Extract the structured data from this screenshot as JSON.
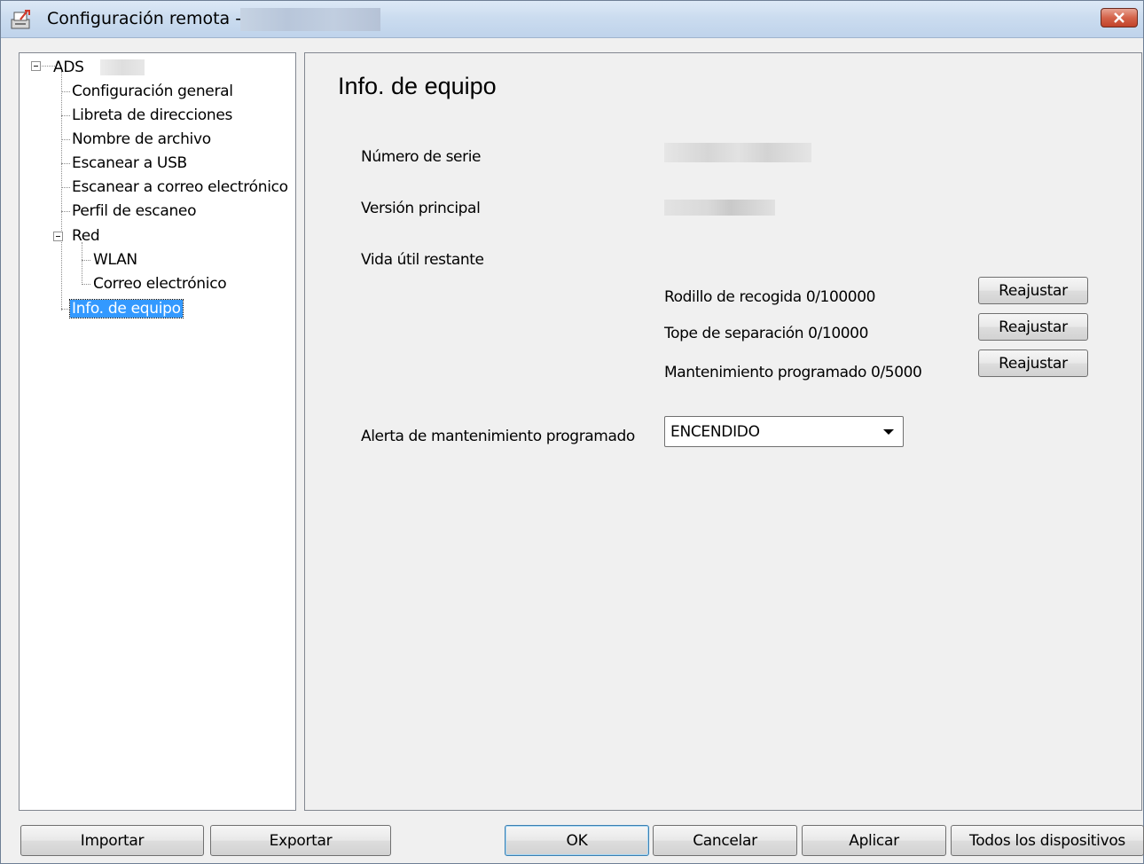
{
  "window": {
    "title": "Configuración remota -",
    "close_icon": "close-icon"
  },
  "tree": {
    "root_label": "ADS",
    "items": [
      {
        "label": "Configuración general"
      },
      {
        "label": "Libreta de direcciones"
      },
      {
        "label": "Nombre de archivo"
      },
      {
        "label": "Escanear a USB"
      },
      {
        "label": "Escanear a correo electrónico"
      },
      {
        "label": "Perfil de escaneo"
      },
      {
        "label": "Red"
      },
      {
        "label": "WLAN"
      },
      {
        "label": "Correo electrónico"
      },
      {
        "label": "Info. de equipo"
      }
    ],
    "selected": "Info. de equipo"
  },
  "main": {
    "title": "Info. de equipo",
    "serial_label": "Número de serie",
    "firmware_label": "Versión principal",
    "life_label": "Vida útil restante",
    "counters": [
      {
        "label": "Rodillo de recogida 0/100000",
        "button": "Reajustar"
      },
      {
        "label": "Tope de separación 0/10000",
        "button": "Reajustar"
      },
      {
        "label": "Mantenimiento programado 0/5000",
        "button": "Reajustar"
      }
    ],
    "alert_label": "Alerta de mantenimiento programado",
    "alert_value": "ENCENDIDO"
  },
  "footer": {
    "import": "Importar",
    "export": "Exportar",
    "ok": "OK",
    "cancel": "Cancelar",
    "apply": "Aplicar",
    "all_devices": "Todos los dispositivos"
  },
  "colors": {
    "selection": "#3399ff",
    "window_bg": "#f0f0f0",
    "close_button": "#c1432a"
  }
}
